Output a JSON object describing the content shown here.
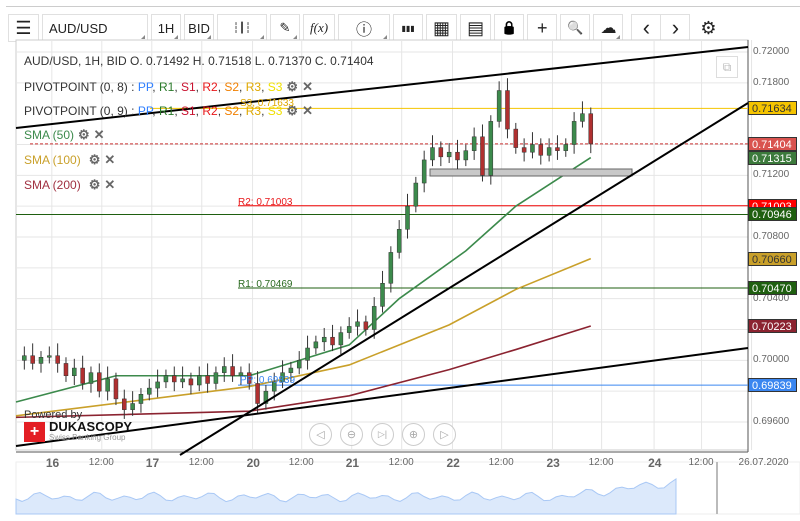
{
  "toolbar": {
    "menu": "☰",
    "symbol": "AUD/USD",
    "period": "1H",
    "side": "BID",
    "candles": "┆┃┆",
    "draw": "✎",
    "fx": "f(x)",
    "info": "ⓘ",
    "bars": "▮▮▮",
    "calendar": "▦",
    "news": "▤",
    "lock": "🔒",
    "crosshair": "+",
    "zoom": "🔍",
    "upload": "☁",
    "prev": "‹",
    "next": "›",
    "settings": "⚙"
  },
  "legend": {
    "ohlc": "AUD/USD, 1H, BID   O. 0.71492 H. 0.71518 L. 0.71370 C. 0.71404",
    "pivot1": {
      "name": "PIVOTPOINT (0, 8)",
      "sep": " : ",
      "items": [
        {
          "t": "PP",
          "c": "#2f7fff"
        },
        {
          "t": "R1",
          "c": "#2a7a2a"
        },
        {
          "t": "S1",
          "c": "#c8102e"
        },
        {
          "t": "R2",
          "c": "#e8171a"
        },
        {
          "t": "S2",
          "c": "#f07f00"
        },
        {
          "t": "R3",
          "c": "#e0a800"
        },
        {
          "t": "S3",
          "c": "#f0e000"
        }
      ]
    },
    "pivot2": {
      "name": "PIVOTPOINT (0, 9)",
      "sep": " : ",
      "items": [
        {
          "t": "PP",
          "c": "#2f7fff"
        },
        {
          "t": "R1",
          "c": "#2a7a2a"
        },
        {
          "t": "S1",
          "c": "#c8102e"
        },
        {
          "t": "R2",
          "c": "#e8171a"
        },
        {
          "t": "S2",
          "c": "#f07f00"
        },
        {
          "t": "R3",
          "c": "#e0a800"
        },
        {
          "t": "S3",
          "c": "#f0e000"
        }
      ]
    },
    "sma50": "SMA (50)",
    "sma100": "SMA (100)",
    "sma200": "SMA (200)",
    "gear": "⚙",
    "close": "✕"
  },
  "pivot_labels": {
    "s3r3": "S3, 0.71633",
    "r2": "R2: 0.71003",
    "r1": "R1: 0.70469",
    "pp": "PP: 0.69839"
  },
  "price_tags": [
    {
      "v": "0.71634",
      "price": 0.71634,
      "bg": "#f5c400",
      "fg": "#333"
    },
    {
      "v": "0.71404",
      "price": 0.71404,
      "bg": "#d9534f",
      "fg": "#fff"
    },
    {
      "v": "0.71315",
      "price": 0.71315,
      "bg": "#3c7a3c",
      "fg": "#fff"
    },
    {
      "v": "0.71003",
      "price": 0.71003,
      "bg": "#ff0000",
      "fg": "#fff"
    },
    {
      "v": "0.70946",
      "price": 0.70946,
      "bg": "#1f5f10",
      "fg": "#fff"
    },
    {
      "v": "0.70660",
      "price": 0.7066,
      "bg": "#c9a02a",
      "fg": "#333"
    },
    {
      "v": "0.70470",
      "price": 0.7047,
      "bg": "#1f5f10",
      "fg": "#fff"
    },
    {
      "v": "0.70223",
      "price": 0.70223,
      "bg": "#8b2330",
      "fg": "#fff"
    },
    {
      "v": "0.69839",
      "price": 0.69839,
      "bg": "#3a86f0",
      "fg": "#fff"
    }
  ],
  "branding": {
    "powered": "Powered by",
    "name": "DUKASCOPY",
    "tagline": "Swiss Banking Group"
  },
  "nav": {
    "back": "◁",
    "zoomout": "⊖",
    "end": "▷|",
    "zoomin": "⊕",
    "fwd": "▷"
  },
  "chart_data": {
    "type": "candlestick",
    "symbol": "AUD/USD",
    "interval": "2h sampled closes",
    "ylim": [
      0.6955,
      0.7205
    ],
    "y_ticks": [
      "0.72000",
      "0.71800",
      "0.71200",
      "0.70800",
      "0.70400",
      "0.70000",
      "0.69600"
    ],
    "y_tick_values": [
      0.72,
      0.718,
      0.712,
      0.708,
      0.704,
      0.7,
      0.696
    ],
    "x_ticks": [
      {
        "t": "16",
        "day": true,
        "i": 4.3
      },
      {
        "t": "12:00",
        "i": 10.3
      },
      {
        "t": "17",
        "day": true,
        "i": 16.3
      },
      {
        "t": "12:00",
        "i": 22.3
      },
      {
        "t": "20",
        "day": true,
        "i": 28.4
      },
      {
        "t": "12:00",
        "i": 34.3
      },
      {
        "t": "21",
        "day": true,
        "i": 40.3
      },
      {
        "t": "12:00",
        "i": 46.3
      },
      {
        "t": "22",
        "day": true,
        "i": 52.4
      },
      {
        "t": "12:00",
        "i": 58.3
      },
      {
        "t": "23",
        "day": true,
        "i": 64.4
      },
      {
        "t": "12:00",
        "i": 70.3
      },
      {
        "t": "24",
        "day": true,
        "i": 76.6
      },
      {
        "t": "12:00",
        "i": 82.3
      },
      {
        "t": "26.07.2020",
        "i": 88.3
      }
    ],
    "closes": [
      0.7,
      0.7003,
      0.6998,
      0.7002,
      0.7003,
      0.6998,
      0.699,
      0.6995,
      0.6985,
      0.6992,
      0.698,
      0.6988,
      0.6975,
      0.6968,
      0.6972,
      0.6978,
      0.6982,
      0.6986,
      0.699,
      0.6986,
      0.6988,
      0.6984,
      0.699,
      0.6985,
      0.6992,
      0.6996,
      0.699,
      0.6992,
      0.6985,
      0.6972,
      0.698,
      0.6986,
      0.6992,
      0.6995,
      0.7,
      0.7008,
      0.7012,
      0.7015,
      0.701,
      0.7018,
      0.7022,
      0.7025,
      0.702,
      0.7035,
      0.705,
      0.707,
      0.7085,
      0.71,
      0.7115,
      0.713,
      0.7138,
      0.7132,
      0.7135,
      0.713,
      0.7136,
      0.7145,
      0.712,
      0.7155,
      0.7175,
      0.715,
      0.7138,
      0.7135,
      0.714,
      0.7133,
      0.7138,
      0.7136,
      0.714,
      0.7155,
      0.716,
      0.71404
    ],
    "sma50": [
      [
        0,
        0.6973
      ],
      [
        12,
        0.699
      ],
      [
        28,
        0.699
      ],
      [
        34,
        0.7
      ],
      [
        40,
        0.701
      ],
      [
        46,
        0.704
      ],
      [
        54,
        0.7071
      ],
      [
        60,
        0.71
      ],
      [
        69,
        0.71315
      ]
    ],
    "sma100": [
      [
        0,
        0.6964
      ],
      [
        28,
        0.6983
      ],
      [
        40,
        0.6997
      ],
      [
        52,
        0.7023
      ],
      [
        60,
        0.7046
      ],
      [
        69,
        0.7066
      ]
    ],
    "sma200": [
      [
        0,
        0.6963
      ],
      [
        28,
        0.6967
      ],
      [
        40,
        0.6977
      ],
      [
        52,
        0.6994
      ],
      [
        60,
        0.7007
      ],
      [
        69,
        0.70223
      ]
    ],
    "pivots": {
      "S3R3": 0.71634,
      "R2": 0.71003,
      "R1": 0.70469,
      "PP": 0.69839,
      "green": 0.70946
    },
    "last": 0.71404
  }
}
